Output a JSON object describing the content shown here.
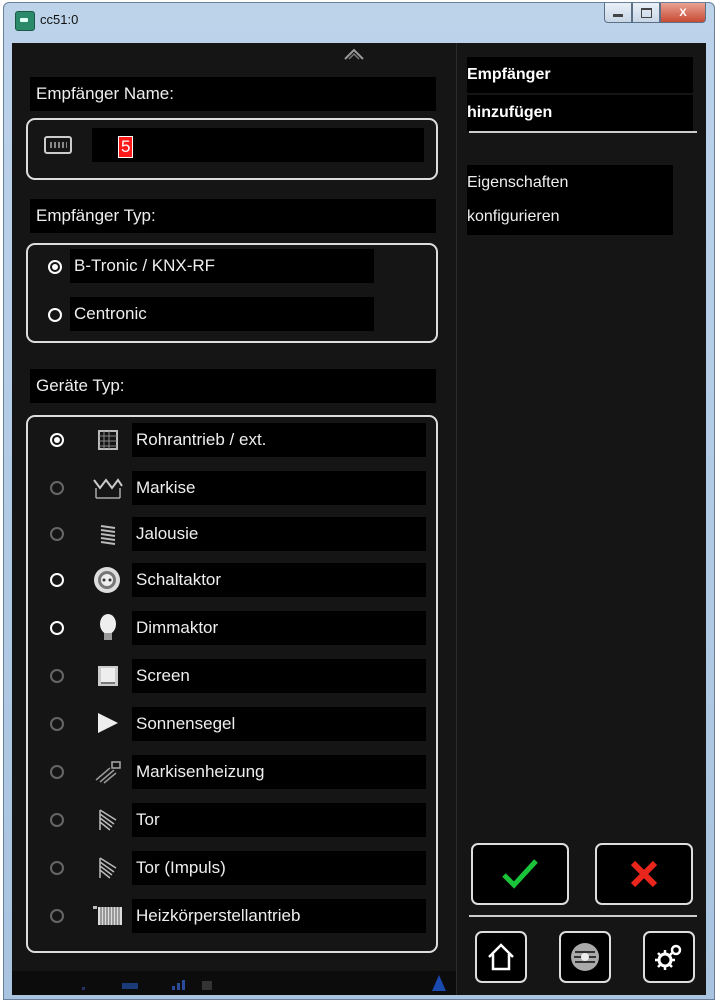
{
  "window": {
    "title": "cc51:0",
    "close_label": "X"
  },
  "form": {
    "name_label": "Empfänger Name:",
    "name_value": "5",
    "type_label": "Empfänger Typ:",
    "receiver_types": [
      {
        "label": "B-Tronic / KNX-RF",
        "selected": true
      },
      {
        "label": "Centronic",
        "selected": false
      }
    ],
    "device_label": "Geräte Typ:",
    "device_types": [
      {
        "label": "Rohrantrieb / ext.",
        "icon": "roller-motor-icon",
        "selected": true
      },
      {
        "label": "Markise",
        "icon": "awning-icon",
        "selected": false
      },
      {
        "label": "Jalousie",
        "icon": "blinds-icon",
        "selected": false
      },
      {
        "label": "Schaltaktor",
        "icon": "switch-actuator-icon",
        "selected": false
      },
      {
        "label": "Dimmaktor",
        "icon": "bulb-icon",
        "selected": false
      },
      {
        "label": "Screen",
        "icon": "screen-icon",
        "selected": false
      },
      {
        "label": "Sonnensegel",
        "icon": "sun-sail-icon",
        "selected": false
      },
      {
        "label": "Markisenheizung",
        "icon": "heater-icon",
        "selected": false
      },
      {
        "label": "Tor",
        "icon": "gate-icon",
        "selected": false
      },
      {
        "label": "Tor (Impuls)",
        "icon": "gate-impulse-icon",
        "selected": false
      },
      {
        "label": "Heizkörperstellantrieb",
        "icon": "radiator-icon",
        "selected": false
      }
    ]
  },
  "sidebar": {
    "title_line1": "Empfänger",
    "title_line2": "hinzufügen",
    "hint_line1": "Eigenschaften",
    "hint_line2": "konfigurieren"
  },
  "colors": {
    "accept": "#19c43a",
    "cancel": "#e8261c",
    "background": "#151515"
  }
}
